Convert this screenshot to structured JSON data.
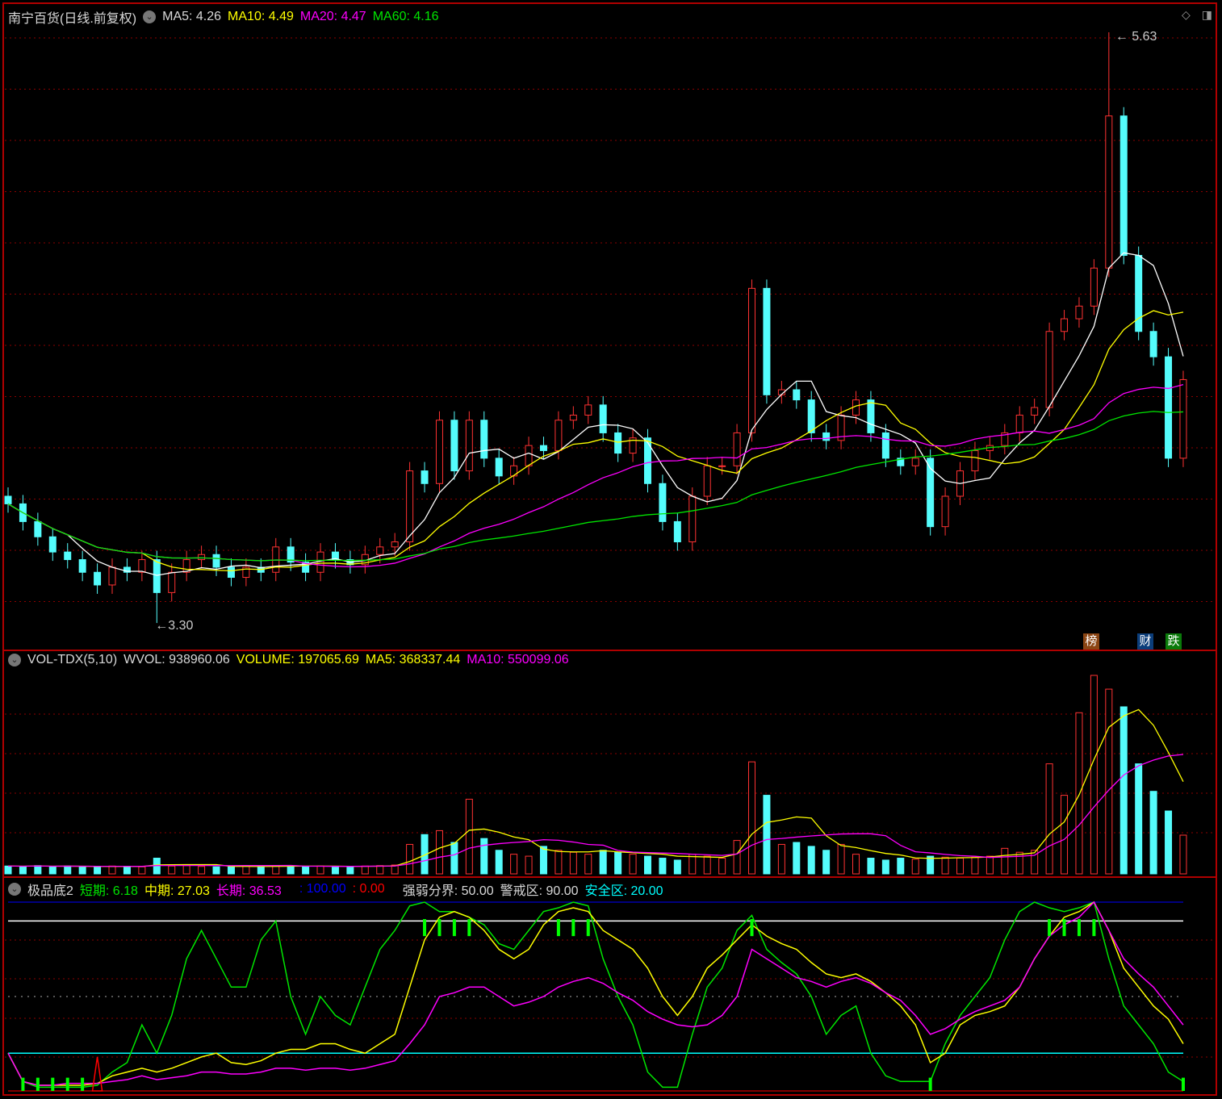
{
  "header": {
    "title": "南宁百货(日线.前复权)",
    "ma5": "MA5: 4.26",
    "ma10": "MA10: 4.49",
    "ma20": "MA20: 4.47",
    "ma60": "MA60: 4.16"
  },
  "volume_header": {
    "name": "VOL-TDX(5,10)",
    "wvol": "WVOL: 938960.06",
    "volume": "VOLUME: 197065.69",
    "ma5": "MA5: 368337.44",
    "ma10": "MA10: 550099.06"
  },
  "indicator_header": {
    "name": "极品底2",
    "short": "短期: 6.18",
    "mid": "中期: 27.03",
    "long": "长期: 36.53",
    "blue": ": 100.00",
    "red": ": 0.00",
    "divide": "强弱分界: 50.00",
    "warn": "警戒区: 90.00",
    "safe": "安全区: 20.00"
  },
  "badges": [
    "榜",
    "财",
    "跌"
  ],
  "colors": {
    "up": "#ff3232",
    "down": "#54fcfc",
    "ma5": "#ffffff",
    "ma10": "#ffff00",
    "ma20": "#ff00ff",
    "ma60": "#00e600",
    "grid": "#8b0000"
  },
  "chart_data": [
    {
      "type": "candlestick",
      "title": "南宁百货(日线.前复权)",
      "ylim": [
        3.3,
        5.63
      ],
      "high_label": "5.63",
      "low_label": "3.30",
      "high_index": 74,
      "low_index": 10,
      "close": [
        3.77,
        3.7,
        3.64,
        3.58,
        3.55,
        3.5,
        3.45,
        3.52,
        3.5,
        3.55,
        3.42,
        3.5,
        3.55,
        3.57,
        3.52,
        3.48,
        3.52,
        3.5,
        3.6,
        3.54,
        3.5,
        3.58,
        3.55,
        3.53,
        3.57,
        3.6,
        3.62,
        3.9,
        3.85,
        4.1,
        3.9,
        4.1,
        3.95,
        3.88,
        3.92,
        4.0,
        3.98,
        4.1,
        4.12,
        4.16,
        4.05,
        3.97,
        4.03,
        3.85,
        3.7,
        3.62,
        3.8,
        3.92,
        3.92,
        4.05,
        4.62,
        4.2,
        4.22,
        4.18,
        4.05,
        4.02,
        4.12,
        4.18,
        4.05,
        3.95,
        3.92,
        3.95,
        3.68,
        3.8,
        3.9,
        3.98,
        4.0,
        4.05,
        4.12,
        4.15,
        4.45,
        4.5,
        4.55,
        4.7,
        5.3,
        4.75,
        4.45,
        4.35,
        3.95,
        4.26
      ]
    },
    {
      "type": "bar",
      "title": "VOL-TDX(5,10)",
      "ylim": [
        0,
        1010000
      ],
      "volume": [
        40000,
        38000,
        42000,
        36000,
        40000,
        38000,
        35000,
        40000,
        38000,
        36000,
        80000,
        40000,
        42000,
        38000,
        36000,
        35000,
        40000,
        38000,
        42000,
        40000,
        38000,
        40000,
        36000,
        38000,
        40000,
        42000,
        45000,
        150000,
        200000,
        220000,
        160000,
        380000,
        180000,
        120000,
        100000,
        90000,
        140000,
        120000,
        110000,
        100000,
        120000,
        110000,
        100000,
        90000,
        80000,
        70000,
        100000,
        90000,
        80000,
        170000,
        570000,
        400000,
        150000,
        160000,
        140000,
        120000,
        150000,
        100000,
        80000,
        70000,
        80000,
        75000,
        90000,
        85000,
        80000,
        85000,
        90000,
        130000,
        110000,
        120000,
        560000,
        400000,
        820000,
        1010000,
        940000,
        850000,
        560000,
        420000,
        320000,
        197065
      ]
    },
    {
      "type": "line",
      "title": "极品底2",
      "ylim": [
        0,
        100
      ],
      "levels": [
        100,
        90,
        50,
        20,
        0
      ],
      "series": [
        {
          "name": "短期",
          "color": "#00e600",
          "values": [
            20,
            5,
            2,
            2,
            2,
            2,
            3,
            10,
            15,
            35,
            20,
            40,
            70,
            85,
            70,
            55,
            55,
            80,
            90,
            50,
            30,
            50,
            40,
            35,
            55,
            75,
            85,
            98,
            100,
            95,
            95,
            92,
            88,
            78,
            75,
            85,
            95,
            97,
            100,
            98,
            70,
            50,
            35,
            10,
            2,
            2,
            30,
            55,
            65,
            85,
            93,
            75,
            68,
            62,
            50,
            30,
            40,
            45,
            20,
            8,
            5,
            5,
            5,
            25,
            40,
            50,
            60,
            80,
            95,
            100,
            97,
            95,
            97,
            100,
            70,
            45,
            35,
            25,
            10,
            5
          ]
        },
        {
          "name": "中期",
          "color": "#ffff00",
          "values": [
            20,
            5,
            3,
            3,
            3,
            3,
            4,
            8,
            10,
            12,
            10,
            12,
            15,
            18,
            20,
            15,
            14,
            16,
            20,
            22,
            22,
            25,
            25,
            22,
            20,
            25,
            30,
            55,
            80,
            92,
            95,
            92,
            85,
            75,
            70,
            75,
            88,
            95,
            97,
            95,
            85,
            80,
            75,
            65,
            50,
            40,
            50,
            65,
            72,
            80,
            88,
            82,
            78,
            75,
            68,
            62,
            60,
            62,
            58,
            52,
            45,
            35,
            15,
            20,
            35,
            40,
            42,
            45,
            55,
            70,
            82,
            92,
            95,
            100,
            85,
            65,
            55,
            45,
            38,
            25
          ]
        },
        {
          "name": "长期",
          "color": "#ff00ff",
          "values": [
            20,
            5,
            3,
            3,
            4,
            4,
            4,
            5,
            6,
            8,
            6,
            7,
            8,
            10,
            10,
            9,
            9,
            10,
            12,
            12,
            11,
            12,
            12,
            11,
            12,
            14,
            16,
            25,
            35,
            50,
            52,
            55,
            55,
            50,
            45,
            47,
            50,
            55,
            58,
            60,
            57,
            52,
            48,
            42,
            38,
            35,
            34,
            35,
            40,
            50,
            75,
            70,
            65,
            60,
            58,
            55,
            58,
            60,
            57,
            52,
            48,
            40,
            30,
            33,
            38,
            42,
            45,
            48,
            55,
            70,
            82,
            88,
            92,
            100,
            85,
            70,
            62,
            55,
            45,
            35
          ]
        }
      ],
      "bottom_signals": [
        1,
        2,
        3,
        4,
        5,
        62,
        79
      ],
      "top_signals": [
        28,
        29,
        30,
        31,
        37,
        38,
        39,
        50,
        70,
        71,
        72,
        73
      ],
      "red_signal": 6
    }
  ]
}
